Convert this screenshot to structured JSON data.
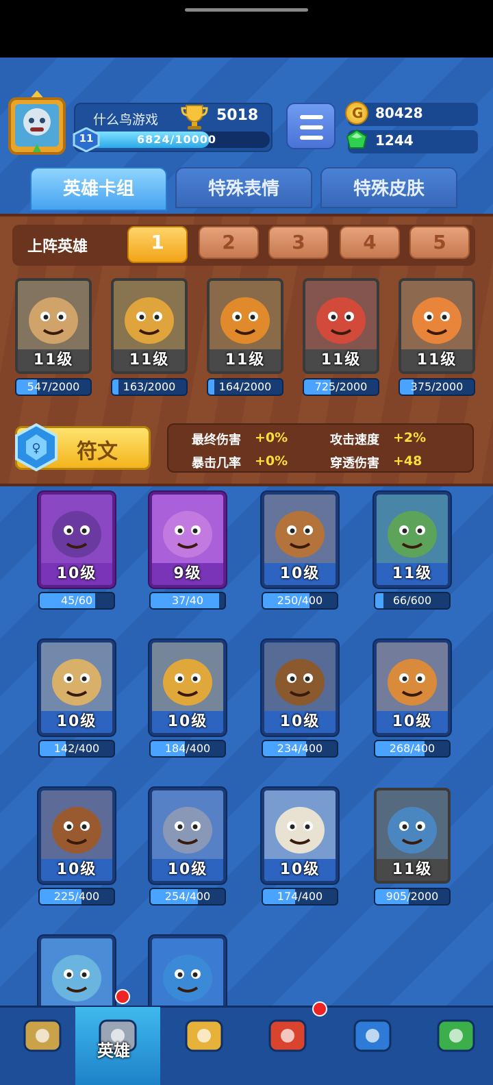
{
  "player": {
    "name": "什么鸟游戏",
    "trophies": "5018",
    "level": "11",
    "xp_text": "6824/10000",
    "xp_progress": 0.6824
  },
  "currency": {
    "coins": "80428",
    "gems": "1244"
  },
  "tabs": [
    {
      "label": "英雄卡组",
      "active": true
    },
    {
      "label": "特殊表情",
      "active": false
    },
    {
      "label": "特殊皮肤",
      "active": false
    }
  ],
  "deck": {
    "label": "上阵英雄",
    "slots": [
      "1",
      "2",
      "3",
      "4",
      "5"
    ],
    "active_slot": "1"
  },
  "deck_heroes": [
    {
      "level": "11级",
      "progress": "547/2000",
      "color": "#cfa36a"
    },
    {
      "level": "11级",
      "progress": "163/2000",
      "color": "#e0a43c"
    },
    {
      "level": "11级",
      "progress": "164/2000",
      "color": "#e08a2c"
    },
    {
      "level": "11级",
      "progress": "725/2000",
      "color": "#d24a3a"
    },
    {
      "level": "11级",
      "progress": "375/2000",
      "color": "#e8853a"
    }
  ],
  "rune": {
    "label": "符文",
    "stats": [
      {
        "name": "最终伤害",
        "value": "+0%"
      },
      {
        "name": "攻击速度",
        "value": "+2%"
      },
      {
        "name": "暴击几率",
        "value": "+0%"
      },
      {
        "name": "穿透伤害",
        "value": "+48"
      }
    ]
  },
  "collection": [
    {
      "level": "10级",
      "progress": "45/60",
      "rarity": "purple",
      "color": "#6b3aa0"
    },
    {
      "level": "9级",
      "progress": "37/40",
      "rarity": "purple",
      "color": "#c27ae0"
    },
    {
      "level": "10级",
      "progress": "250/400",
      "rarity": "blue",
      "color": "#b3733a"
    },
    {
      "level": "11级",
      "progress": "66/600",
      "rarity": "blue",
      "color": "#5ea35a"
    },
    {
      "level": "10级",
      "progress": "142/400",
      "rarity": "blue",
      "color": "#d8b06a"
    },
    {
      "level": "10级",
      "progress": "184/400",
      "rarity": "blue",
      "color": "#e0a73a"
    },
    {
      "level": "10级",
      "progress": "234/400",
      "rarity": "blue",
      "color": "#8a5a2e"
    },
    {
      "level": "10级",
      "progress": "268/400",
      "rarity": "blue",
      "color": "#d98a3a"
    },
    {
      "level": "10级",
      "progress": "225/400",
      "rarity": "blue",
      "color": "#9a5a30"
    },
    {
      "level": "10级",
      "progress": "254/400",
      "rarity": "blue",
      "color": "#8a98b8"
    },
    {
      "level": "10级",
      "progress": "174/400",
      "rarity": "blue",
      "color": "#e8e2d2"
    },
    {
      "level": "11级",
      "progress": "905/2000",
      "rarity": "gray",
      "color": "#4a86c0"
    },
    {
      "level": "",
      "progress": "",
      "rarity": "blue",
      "color": "#6ab4e0"
    },
    {
      "level": "",
      "progress": "",
      "rarity": "blue",
      "color": "#3a8ad8"
    }
  ],
  "bottom_nav": [
    {
      "icon": "treasure-chest-icon",
      "label": ""
    },
    {
      "icon": "knight-helmet-icon",
      "label": "英雄"
    },
    {
      "icon": "crossed-swords-icon",
      "label": ""
    },
    {
      "icon": "crown-shield-icon",
      "label": ""
    },
    {
      "icon": "team-banner-icon",
      "label": ""
    },
    {
      "icon": "sprout-island-icon",
      "label": ""
    }
  ]
}
